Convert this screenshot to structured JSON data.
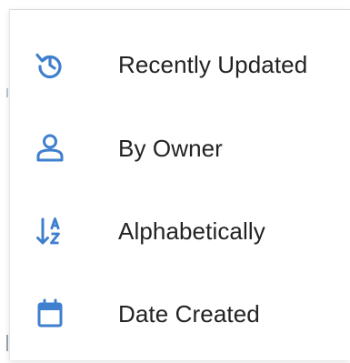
{
  "menu": {
    "items": [
      {
        "label": "Recently Updated",
        "icon": "history-icon"
      },
      {
        "label": "By Owner",
        "icon": "person-icon"
      },
      {
        "label": "Alphabetically",
        "icon": "sort-alpha-icon"
      },
      {
        "label": "Date Created",
        "icon": "calendar-icon"
      }
    ]
  },
  "colors": {
    "icon": "#3f7fcf",
    "text": "#222222"
  }
}
